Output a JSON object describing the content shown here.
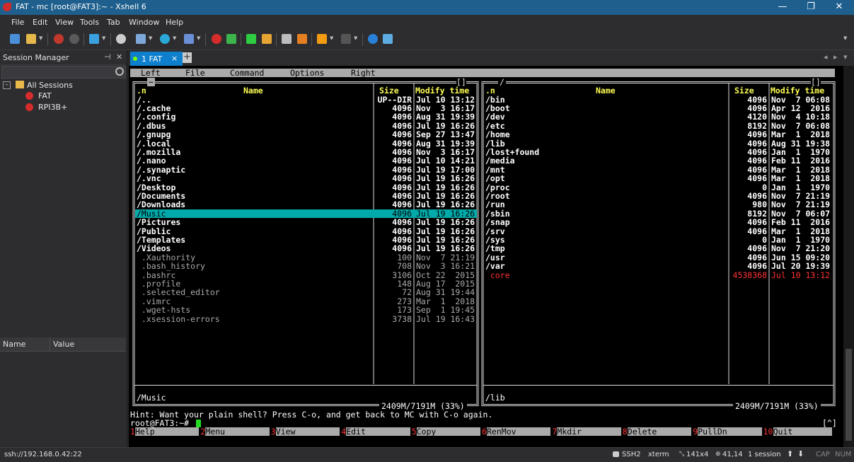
{
  "window": {
    "title": "FAT - mc [root@FAT3]:~ - Xshell 6",
    "minimize": "—",
    "maximize": "❐",
    "close": "✕"
  },
  "menu": [
    "File",
    "Edit",
    "View",
    "Tools",
    "Tab",
    "Window",
    "Help"
  ],
  "session_manager": {
    "title": "Session Manager",
    "pin": "⊣",
    "close": "✕",
    "tree": [
      {
        "label": "All Sessions",
        "expander": "–"
      },
      {
        "label": "FAT"
      },
      {
        "label": "RPI3B+"
      }
    ],
    "props_headers": {
      "name": "Name",
      "value": "Value"
    }
  },
  "tabs": {
    "active_label": "1 FAT",
    "close": "×",
    "add": "+",
    "prev": "◂",
    "next": "▸",
    "menu": "▾"
  },
  "mc": {
    "menu": [
      "Left",
      "File",
      "Command",
      "Options",
      "Right"
    ],
    "left_dir": "~",
    "right_dir": "/",
    "headers": {
      "name_abbr": ".n",
      "name": "Name",
      "size": "Size",
      "modify": "Modify time"
    },
    "left_files": [
      {
        "name": "/..",
        "size": "UP--DIR",
        "date": "Jul 10 13:12",
        "type": "dir"
      },
      {
        "name": "/.cache",
        "size": "4096",
        "date": "Nov  3 16:17",
        "type": "dir"
      },
      {
        "name": "/.config",
        "size": "4096",
        "date": "Aug 31 19:39",
        "type": "dir"
      },
      {
        "name": "/.dbus",
        "size": "4096",
        "date": "Jul 19 16:26",
        "type": "dir"
      },
      {
        "name": "/.gnupg",
        "size": "4096",
        "date": "Sep 27 13:47",
        "type": "dir"
      },
      {
        "name": "/.local",
        "size": "4096",
        "date": "Aug 31 19:39",
        "type": "dir"
      },
      {
        "name": "/.mozilla",
        "size": "4096",
        "date": "Nov  3 16:17",
        "type": "dir"
      },
      {
        "name": "/.nano",
        "size": "4096",
        "date": "Jul 10 14:21",
        "type": "dir"
      },
      {
        "name": "/.synaptic",
        "size": "4096",
        "date": "Jul 19 17:00",
        "type": "dir"
      },
      {
        "name": "/.vnc",
        "size": "4096",
        "date": "Jul 19 16:26",
        "type": "dir"
      },
      {
        "name": "/Desktop",
        "size": "4096",
        "date": "Jul 19 16:26",
        "type": "dir"
      },
      {
        "name": "/Documents",
        "size": "4096",
        "date": "Jul 19 16:26",
        "type": "dir"
      },
      {
        "name": "/Downloads",
        "size": "4096",
        "date": "Jul 19 16:26",
        "type": "dir"
      },
      {
        "name": "/Music",
        "size": "4096",
        "date": "Jul 19 16:26",
        "type": "selected"
      },
      {
        "name": "/Pictures",
        "size": "4096",
        "date": "Jul 19 16:26",
        "type": "dir"
      },
      {
        "name": "/Public",
        "size": "4096",
        "date": "Jul 19 16:26",
        "type": "dir"
      },
      {
        "name": "/Templates",
        "size": "4096",
        "date": "Jul 19 16:26",
        "type": "dir"
      },
      {
        "name": "/Videos",
        "size": "4096",
        "date": "Jul 19 16:26",
        "type": "dir"
      },
      {
        "name": " .Xauthority",
        "size": "100",
        "date": "Nov  7 21:19",
        "type": "file"
      },
      {
        "name": " .bash_history",
        "size": "708",
        "date": "Nov  3 16:21",
        "type": "file"
      },
      {
        "name": " .bashrc",
        "size": "3106",
        "date": "Oct 22  2015",
        "type": "file"
      },
      {
        "name": " .profile",
        "size": "148",
        "date": "Aug 17  2015",
        "type": "file"
      },
      {
        "name": " .selected_editor",
        "size": "72",
        "date": "Aug 31 19:44",
        "type": "file"
      },
      {
        "name": " .vimrc",
        "size": "273",
        "date": "Mar  1  2018",
        "type": "file"
      },
      {
        "name": " .wget-hsts",
        "size": "173",
        "date": "Sep  1 19:45",
        "type": "file"
      },
      {
        "name": " .xsession-errors",
        "size": "3738",
        "date": "Jul 19 16:43",
        "type": "file"
      }
    ],
    "right_files": [
      {
        "name": "/bin",
        "size": "4096",
        "date": "Nov  7 06:08",
        "type": "dir"
      },
      {
        "name": "/boot",
        "size": "4096",
        "date": "Apr 12  2016",
        "type": "dir"
      },
      {
        "name": "/dev",
        "size": "4120",
        "date": "Nov  4 10:18",
        "type": "dir"
      },
      {
        "name": "/etc",
        "size": "8192",
        "date": "Nov  7 06:08",
        "type": "dir"
      },
      {
        "name": "/home",
        "size": "4096",
        "date": "Mar  1  2018",
        "type": "dir"
      },
      {
        "name": "/lib",
        "size": "4096",
        "date": "Aug 31 19:38",
        "type": "dir"
      },
      {
        "name": "/lost+found",
        "size": "4096",
        "date": "Jan  1  1970",
        "type": "dir"
      },
      {
        "name": "/media",
        "size": "4096",
        "date": "Feb 11  2016",
        "type": "dir"
      },
      {
        "name": "/mnt",
        "size": "4096",
        "date": "Mar  1  2018",
        "type": "dir"
      },
      {
        "name": "/opt",
        "size": "4096",
        "date": "Mar  1  2018",
        "type": "dir"
      },
      {
        "name": "/proc",
        "size": "0",
        "date": "Jan  1  1970",
        "type": "dir"
      },
      {
        "name": "/root",
        "size": "4096",
        "date": "Nov  7 21:19",
        "type": "dir"
      },
      {
        "name": "/run",
        "size": "980",
        "date": "Nov  7 21:19",
        "type": "dir"
      },
      {
        "name": "/sbin",
        "size": "8192",
        "date": "Nov  7 06:07",
        "type": "dir"
      },
      {
        "name": "/snap",
        "size": "4096",
        "date": "Feb 11  2016",
        "type": "dir"
      },
      {
        "name": "/srv",
        "size": "4096",
        "date": "Mar  1  2018",
        "type": "dir"
      },
      {
        "name": "/sys",
        "size": "0",
        "date": "Jan  1  1970",
        "type": "dir"
      },
      {
        "name": "/tmp",
        "size": "4096",
        "date": "Nov  7 21:20",
        "type": "dir"
      },
      {
        "name": "/usr",
        "size": "4096",
        "date": "Jun 15 09:20",
        "type": "dir"
      },
      {
        "name": "/var",
        "size": "4096",
        "date": "Jul 20 19:39",
        "type": "dir"
      },
      {
        "name": " core",
        "size": "4538368",
        "date": "Jul 10 13:12",
        "type": "core"
      }
    ],
    "left_status": "/Music",
    "right_status": "/lib",
    "left_free": "2409M/7191M (33%)",
    "right_free": "2409M/7191M (33%)",
    "hint": "Hint: Want your plain shell? Press C-o, and get back to MC with C-o again.",
    "prompt": "root@FAT3:~#",
    "keybar": [
      {
        "num": "1",
        "label": "Help"
      },
      {
        "num": "2",
        "label": "Menu"
      },
      {
        "num": "3",
        "label": "View"
      },
      {
        "num": "4",
        "label": "Edit"
      },
      {
        "num": "5",
        "label": "Copy"
      },
      {
        "num": "6",
        "label": "RenMov"
      },
      {
        "num": "7",
        "label": "Mkdir"
      },
      {
        "num": "8",
        "label": "Delete"
      },
      {
        "num": "9",
        "label": "PullDn"
      },
      {
        "num": "10",
        "label": "Quit"
      }
    ],
    "hidden_toggle": "[^]",
    "panel_btn": "[]"
  },
  "status": {
    "address": "ssh://192.168.0.42:22",
    "protocol": "SSH2",
    "term": "xterm",
    "size": "141x4",
    "cursor": "41,14",
    "sessions": "1 session",
    "caps": "CAP",
    "num": "NUM"
  },
  "colors": {
    "accent": "#0e7fcc",
    "titlebar": "#1e5f8e",
    "terminal_bg": "#000000",
    "mc_highlight": "#00aaaa",
    "mc_yellow": "#ffff55",
    "mc_red": "#ff3333",
    "mc_gray": "#aaaaaa"
  }
}
